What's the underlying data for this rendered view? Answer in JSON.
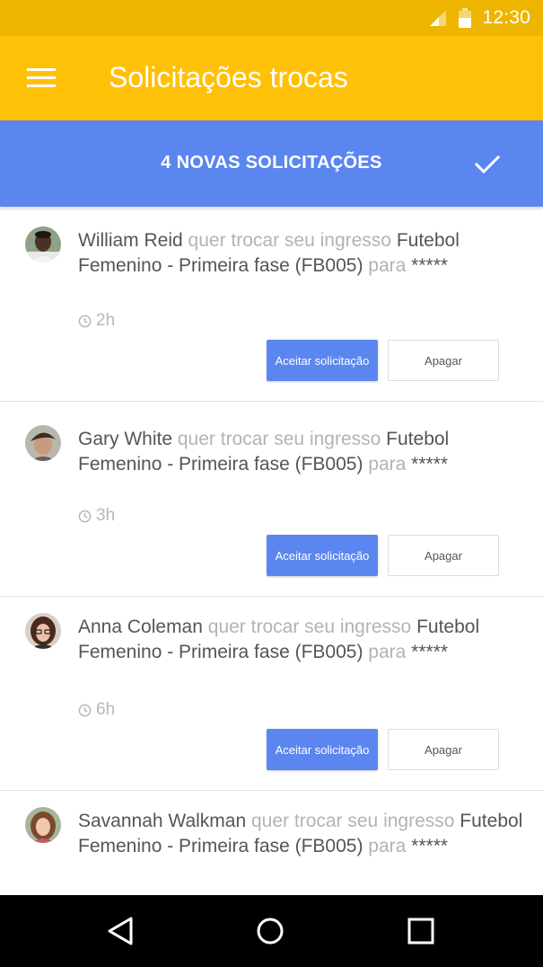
{
  "status_bar": {
    "time": "12:30",
    "icons": [
      "signal-icon",
      "battery-icon"
    ]
  },
  "app_bar": {
    "title": "Solicitações trocas",
    "menu_icon": "menu-icon"
  },
  "banner": {
    "text": "4 NOVAS SOLICITAÇÕES",
    "action_icon": "check-icon"
  },
  "requests": [
    {
      "name": "William Reid",
      "action": "quer trocar seu ingresso",
      "item": "Futebol Femenino - Primeira fase (FB005)",
      "connector": "para",
      "target": "*****",
      "time": "2h",
      "accept_label": "Aceitar solicitação",
      "delete_label": "Apagar"
    },
    {
      "name": "Gary White",
      "action": "quer trocar seu ingresso",
      "item": "Futebol Femenino - Primeira fase (FB005)",
      "connector": "para",
      "target": "*****",
      "time": "3h",
      "accept_label": "Aceitar solicitação",
      "delete_label": "Apagar"
    },
    {
      "name": "Anna Coleman",
      "action": "quer trocar seu ingresso",
      "item": "Futebol Femenino - Primeira fase (FB005)",
      "connector": "para",
      "target": "*****",
      "time": "6h",
      "accept_label": "Aceitar solicitação",
      "delete_label": "Apagar"
    },
    {
      "name": "Savannah Walkman",
      "action": "quer trocar seu ingresso",
      "item": "Futebol Femenino - Primeira fase (FB005)",
      "connector": "para",
      "target": "*****"
    }
  ],
  "nav_bar": {
    "icons": [
      "back-icon",
      "home-icon",
      "recents-icon"
    ]
  },
  "colors": {
    "status_bar": "#EDB500",
    "app_bar": "#FFC107",
    "accent": "#5B86F0",
    "nav_bar": "#000000"
  }
}
